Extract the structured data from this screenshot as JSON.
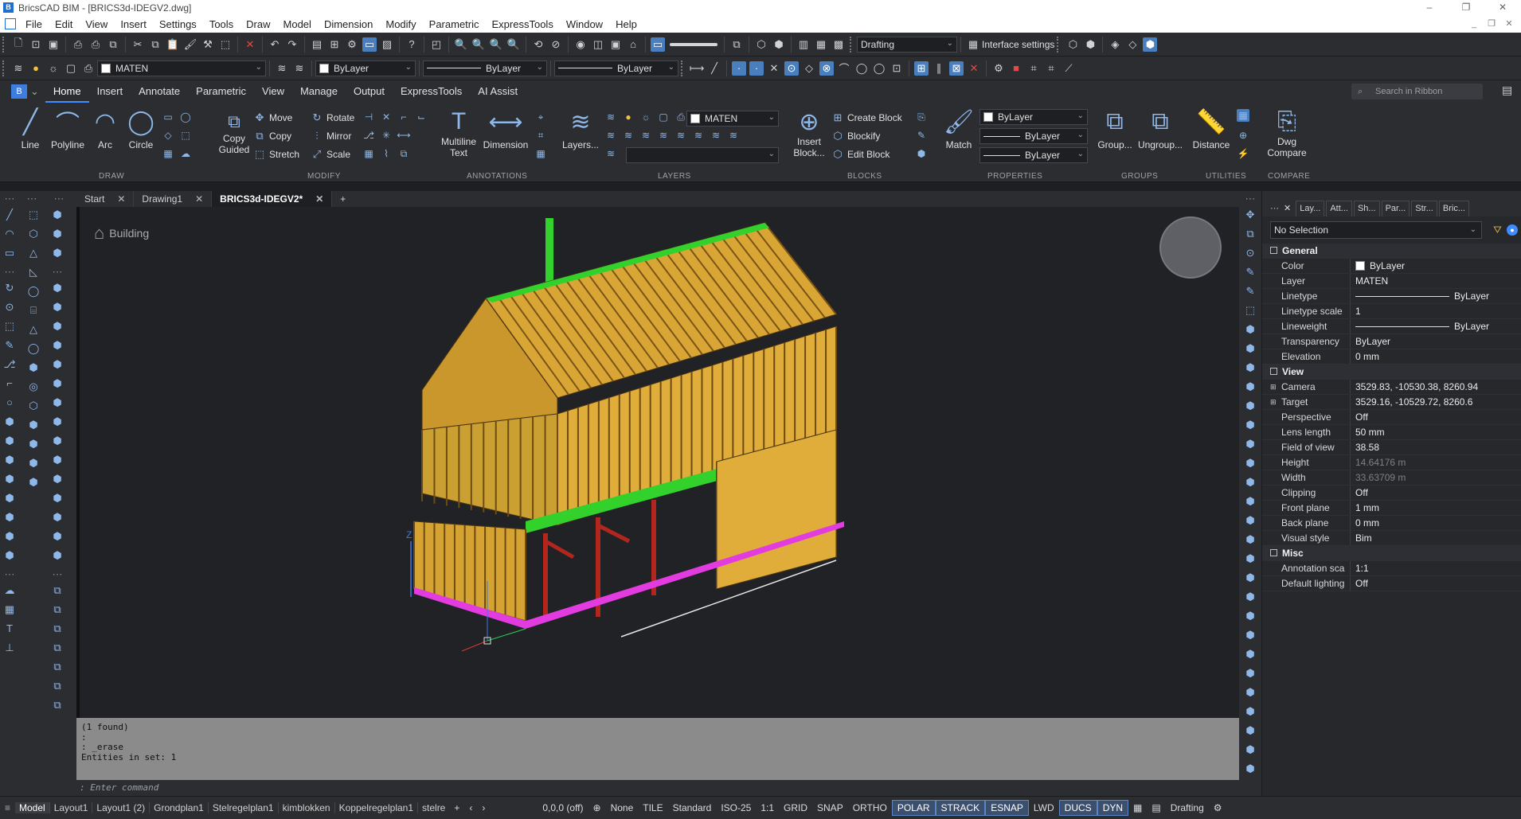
{
  "window": {
    "title": "BricsCAD BIM - [BRICS3d-IDEGV2.dwg]",
    "controls": [
      "–",
      "❐",
      "✕"
    ]
  },
  "menu": [
    "File",
    "Edit",
    "View",
    "Insert",
    "Settings",
    "Tools",
    "Draw",
    "Model",
    "Dimension",
    "Modify",
    "Parametric",
    "ExpressTools",
    "Window",
    "Help"
  ],
  "toolbar1": {
    "workspace": "Drafting",
    "interface_settings": "Interface settings"
  },
  "toolbar2": {
    "layer": "MATEN",
    "color": "ByLayer",
    "linetype": "ByLayer",
    "lineweight": "ByLayer"
  },
  "ribbon_tabs": [
    "Home",
    "Insert",
    "Annotate",
    "Parametric",
    "View",
    "Manage",
    "Output",
    "ExpressTools",
    "AI Assist"
  ],
  "ribbon_search_placeholder": "Search in Ribbon",
  "ribbon": {
    "draw": {
      "label": "DRAW",
      "line": "Line",
      "polyline": "Polyline",
      "arc": "Arc",
      "circle": "Circle"
    },
    "modify": {
      "label": "MODIFY",
      "copy_guided_1": "Copy",
      "copy_guided_2": "Guided",
      "move": "Move",
      "copy": "Copy",
      "stretch": "Stretch",
      "rotate": "Rotate",
      "mirror": "Mirror",
      "scale": "Scale"
    },
    "annotations": {
      "label": "ANNOTATIONS",
      "mtext_1": "Multiline",
      "mtext_2": "Text",
      "dimension": "Dimension"
    },
    "layers": {
      "label": "LAYERS",
      "layers_btn": "Layers...",
      "current": "MATEN"
    },
    "blocks": {
      "label": "BLOCKS",
      "insert_1": "Insert",
      "insert_2": "Block...",
      "create": "Create Block",
      "blockify": "Blockify",
      "edit": "Edit Block"
    },
    "properties": {
      "label": "PROPERTIES",
      "match": "Match",
      "color": "ByLayer",
      "linetype": "ByLayer",
      "lineweight": "ByLayer"
    },
    "groups": {
      "label": "GROUPS",
      "group": "Group...",
      "ungroup": "Ungroup..."
    },
    "utilities": {
      "label": "UTILITIES",
      "distance": "Distance"
    },
    "compare": {
      "label": "COMPARE",
      "dwg_1": "Dwg",
      "dwg_2": "Compare"
    }
  },
  "doc_tabs": [
    {
      "label": "Start",
      "active": false
    },
    {
      "label": "Drawing1",
      "active": false
    },
    {
      "label": "BRICS3d-IDEGV2*",
      "active": true
    }
  ],
  "viewport": {
    "breadcrumb": "Building",
    "z_axis": "Z"
  },
  "properties_panel": {
    "tabs": [
      "Lay...",
      "Att...",
      "Sh...",
      "Par...",
      "Str...",
      "Bric..."
    ],
    "selection": "No Selection",
    "general": {
      "label": "General",
      "rows": [
        {
          "k": "Color",
          "v": "ByLayer",
          "kind": "swatch"
        },
        {
          "k": "Layer",
          "v": "MATEN"
        },
        {
          "k": "Linetype",
          "v": "ByLayer",
          "kind": "line"
        },
        {
          "k": "Linetype scale",
          "v": "1"
        },
        {
          "k": "Lineweight",
          "v": "ByLayer",
          "kind": "line"
        },
        {
          "k": "Transparency",
          "v": "ByLayer"
        },
        {
          "k": "Elevation",
          "v": "0 mm"
        }
      ]
    },
    "view": {
      "label": "View",
      "rows": [
        {
          "k": "Camera",
          "v": "3529.83, -10530.38, 8260.94",
          "expand": true
        },
        {
          "k": "Target",
          "v": "3529.16, -10529.72, 8260.6",
          "expand": true
        },
        {
          "k": "Perspective",
          "v": "Off"
        },
        {
          "k": "Lens length",
          "v": "50 mm"
        },
        {
          "k": "Field of view",
          "v": "38.58"
        },
        {
          "k": "Height",
          "v": "14.64176 m",
          "dim": true
        },
        {
          "k": "Width",
          "v": "33.63709 m",
          "dim": true
        },
        {
          "k": "Clipping",
          "v": "Off"
        },
        {
          "k": "Front plane",
          "v": "1 mm"
        },
        {
          "k": "Back plane",
          "v": "0 mm"
        },
        {
          "k": "Visual style",
          "v": "Bim"
        }
      ]
    },
    "misc": {
      "label": "Misc",
      "rows": [
        {
          "k": "Annotation sca",
          "v": "1:1"
        },
        {
          "k": "Default lighting",
          "v": "Off"
        }
      ]
    }
  },
  "command_history": [
    "(1 found)",
    ":",
    ": _erase",
    "Entities in set: 1"
  ],
  "command_prompt": ": Enter command",
  "status_bar": {
    "layout_tabs": [
      "Model",
      "Layout1",
      "Layout1 (2)",
      "Grondplan1",
      "Stelregelplan1",
      "kimblokken",
      "Koppelregelplan1",
      "stelre"
    ],
    "coords": "0,0,0 (off)",
    "none": "None",
    "tile": "TILE",
    "style": "Standard",
    "dimstyle": "ISO-25",
    "scale": "1:1",
    "toggles": [
      {
        "label": "GRID",
        "on": false
      },
      {
        "label": "SNAP",
        "on": false
      },
      {
        "label": "ORTHO",
        "on": false
      },
      {
        "label": "POLAR",
        "on": true
      },
      {
        "label": "STRACK",
        "on": true
      },
      {
        "label": "ESNAP",
        "on": true
      },
      {
        "label": "LWD",
        "on": false
      },
      {
        "label": "DUCS",
        "on": true
      },
      {
        "label": "DYN",
        "on": true
      }
    ],
    "workspace": "Drafting"
  },
  "colors": {
    "timber": "#e8b53c",
    "roof_green": "#33d12c",
    "sill_magenta": "#e23be0",
    "post_red": "#b3261e",
    "accent": "#3f8cff"
  }
}
